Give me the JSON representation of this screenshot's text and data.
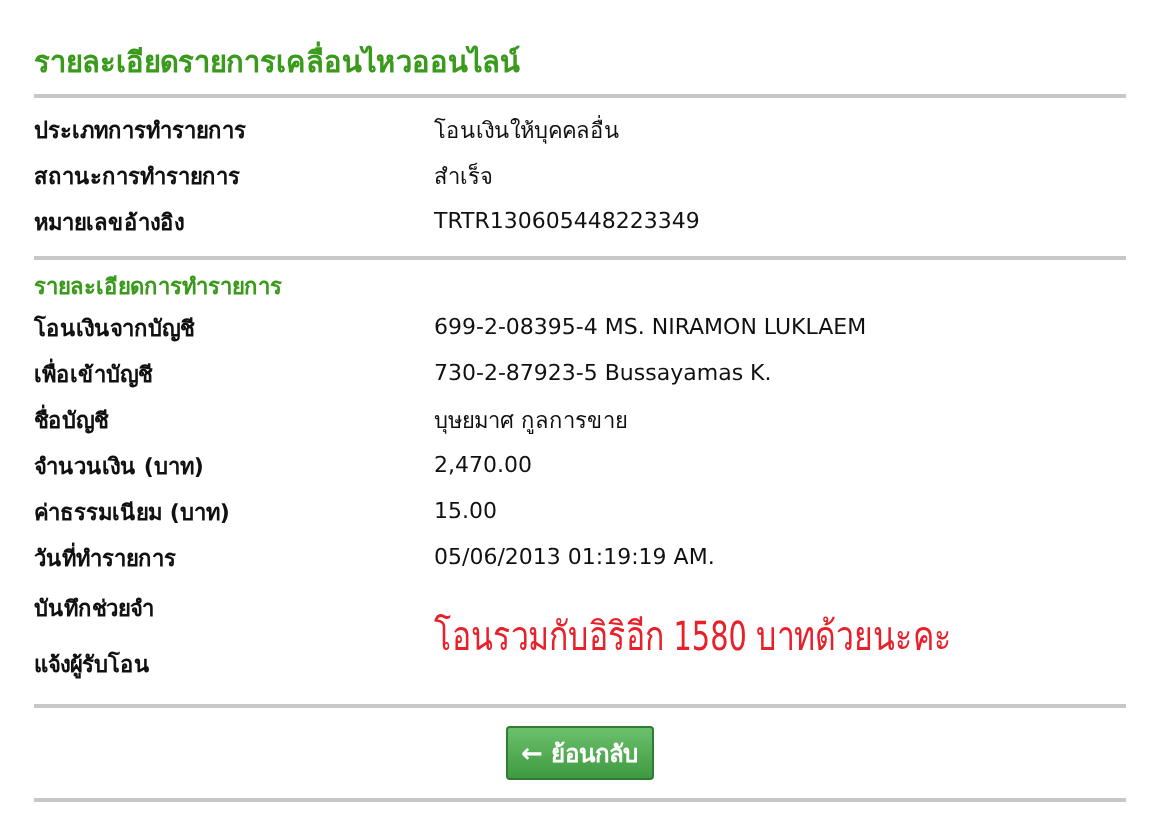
{
  "title": "รายละเอียดรายการเคลื่อนไหวออนไลน์",
  "summary": [
    {
      "label": "ประเภทการทำรายการ",
      "value": "โอนเงินให้บุคคลอื่น"
    },
    {
      "label": "สถานะการทำรายการ",
      "value": "สำเร็จ"
    },
    {
      "label": "หมายเลขอ้างอิง",
      "value": "TRTR130605448223349"
    }
  ],
  "details": {
    "heading": "รายละเอียดการทำรายการ",
    "rows": [
      {
        "label": "โอนเงินจากบัญชี",
        "value": "699-2-08395-4 MS. NIRAMON LUKLAEM"
      },
      {
        "label": "เพื่อเข้าบัญชี",
        "value": "730-2-87923-5 Bussayamas K."
      },
      {
        "label": "ชื่อบัญชี",
        "value": "บุษยมาศ กูลการขาย"
      },
      {
        "label": "จำนวนเงิน (บาท)",
        "value": "2,470.00"
      },
      {
        "label": "ค่าธรรมเนียม (บาท)",
        "value": "15.00"
      },
      {
        "label": "วันที่ทำรายการ",
        "value": "05/06/2013 01:19:19 AM."
      }
    ],
    "memo_labels": [
      "บันทึกช่วยจำ",
      "แจ้งผู้รับโอน"
    ],
    "memo_note": "โอนรวมกับอิริอีก 1580 บาทด้วยนะคะ"
  },
  "back_button": {
    "arrow": "←",
    "label": "ย้อนกลับ"
  }
}
